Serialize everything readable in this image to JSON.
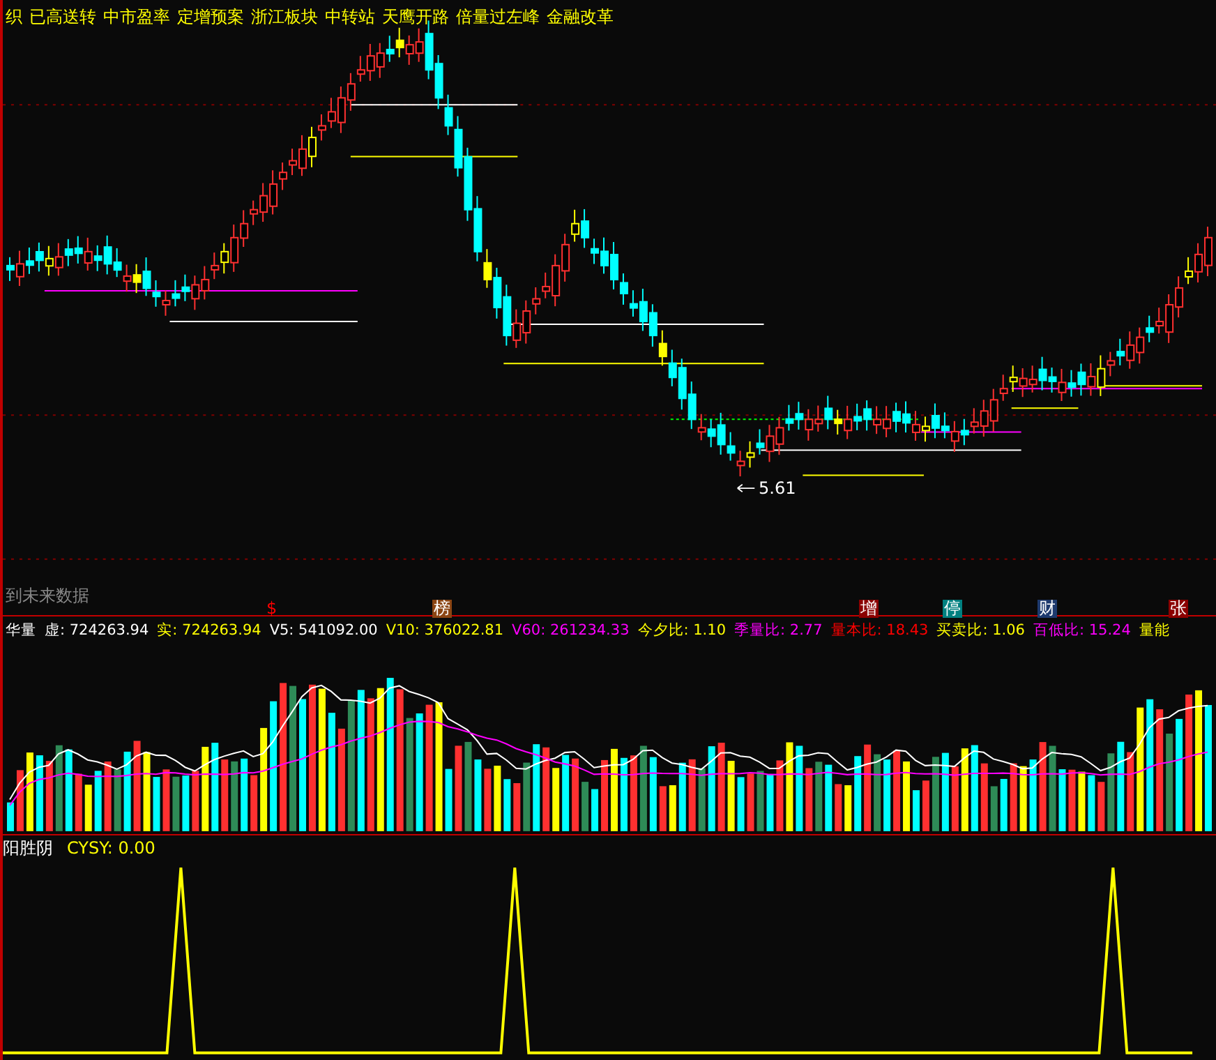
{
  "top_labels": [
    "织",
    "已高送转",
    "中市盈率",
    "定增预案",
    "浙江板块",
    "中转站",
    "天鹰开路",
    "倍量过左峰",
    "金融改革"
  ],
  "main_chart": {
    "price_label": "5.61",
    "notice": "到未来数据"
  },
  "markers": [
    {
      "text": "$",
      "kind": "plain",
      "color": "#ff0000"
    },
    {
      "text": "榜",
      "kind": "badge",
      "color": "#8b4513"
    },
    {
      "text": "增",
      "kind": "badge",
      "color": "#8b0000"
    },
    {
      "text": "停",
      "kind": "badge",
      "color": "#008080"
    },
    {
      "text": "财",
      "kind": "badge",
      "color": "#1e3a6e"
    },
    {
      "text": "张",
      "kind": "badge",
      "color": "#8b0000"
    }
  ],
  "volume_header": {
    "title": "华量",
    "items": [
      {
        "label": "虚:",
        "value": "724263.94",
        "color": "#ffffff"
      },
      {
        "label": "实:",
        "value": "724263.94",
        "color": "#ffff00"
      },
      {
        "label": "V5:",
        "value": "541092.00",
        "color": "#ffffff"
      },
      {
        "label": "V10:",
        "value": "376022.81",
        "color": "#ffff00"
      },
      {
        "label": "V60:",
        "value": "261234.33",
        "color": "#ff00ff"
      },
      {
        "label": "今夕比:",
        "value": "1.10",
        "color": "#ffff00"
      },
      {
        "label": "季量比:",
        "value": "2.77",
        "color": "#ff00ff"
      },
      {
        "label": "量本比:",
        "value": "18.43",
        "color": "#ff0000"
      },
      {
        "label": "买卖比:",
        "value": "1.06",
        "color": "#ffff00"
      },
      {
        "label": "百低比:",
        "value": "15.24",
        "color": "#ff00ff"
      },
      {
        "label": "量能",
        "value": "",
        "color": "#ffff00"
      }
    ]
  },
  "indicator_header": {
    "title": "阳胜阴",
    "label": "CYSY:",
    "value": "0.00"
  }
}
